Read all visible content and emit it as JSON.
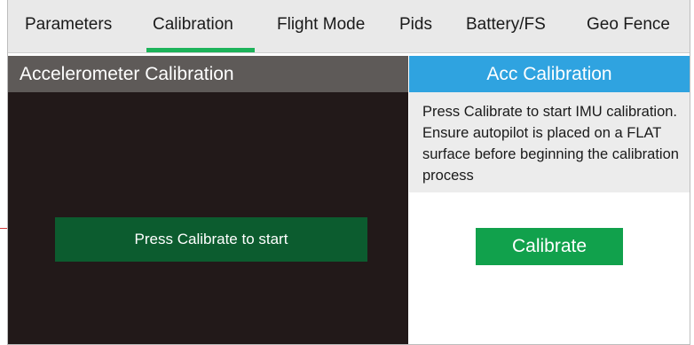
{
  "tabs": [
    {
      "label": "Parameters"
    },
    {
      "label": "Calibration"
    },
    {
      "label": "Flight Mode"
    },
    {
      "label": "Pids"
    },
    {
      "label": "Battery/FS"
    },
    {
      "label": "Geo Fence"
    }
  ],
  "active_tab": "Calibration",
  "accent_color": "#1db35a",
  "left_panel": {
    "title": "Accelerometer Calibration",
    "status_text": "Press Calibrate to start"
  },
  "right_panel": {
    "title": "Acc Calibration",
    "instructions": "Press Calibrate to start IMU calibration. Ensure autopilot is placed on a FLAT surface before beginning the calibration process",
    "calibrate_label": "Calibrate"
  }
}
